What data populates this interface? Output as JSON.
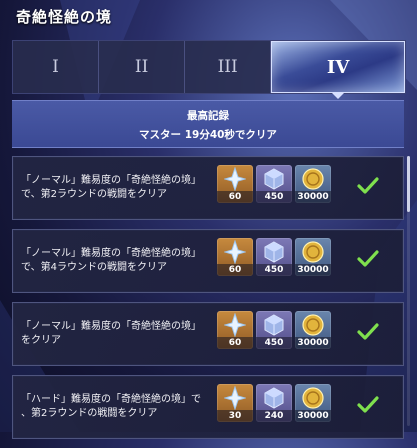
{
  "title": "奇絶怪絶の境",
  "tabs": [
    {
      "label": "I",
      "active": false
    },
    {
      "label": "II",
      "active": false
    },
    {
      "label": "III",
      "active": false
    },
    {
      "label": "IV",
      "active": true
    }
  ],
  "record": {
    "heading": "最高記録",
    "detail": "マスター 19分40秒でクリア"
  },
  "missions": [
    {
      "line1": "「ノーマル」難易度の「奇絶怪絶の境」",
      "line2": "で、第2ラウンドの戦闘をクリア",
      "rewards": [
        {
          "icon": "star-crystal-icon",
          "amount": "60",
          "color": "gold"
        },
        {
          "icon": "cube-material-icon",
          "amount": "450",
          "color": "purple"
        },
        {
          "icon": "gold-coin-icon",
          "amount": "30000",
          "color": "blue"
        }
      ],
      "completed": true
    },
    {
      "line1": "「ノーマル」難易度の「奇絶怪絶の境」",
      "line2": "で、第4ラウンドの戦闘をクリア",
      "rewards": [
        {
          "icon": "star-crystal-icon",
          "amount": "60",
          "color": "gold"
        },
        {
          "icon": "cube-material-icon",
          "amount": "450",
          "color": "purple"
        },
        {
          "icon": "gold-coin-icon",
          "amount": "30000",
          "color": "blue"
        }
      ],
      "completed": true
    },
    {
      "line1": "「ノーマル」難易度の「奇絶怪絶の境」",
      "line2": "をクリア",
      "rewards": [
        {
          "icon": "star-crystal-icon",
          "amount": "60",
          "color": "gold"
        },
        {
          "icon": "cube-material-icon",
          "amount": "450",
          "color": "purple"
        },
        {
          "icon": "gold-coin-icon",
          "amount": "30000",
          "color": "blue"
        }
      ],
      "completed": true
    },
    {
      "line1": "「ハード」難易度の「奇絶怪絶の境」で",
      "line2": "、第2ラウンドの戦闘をクリア",
      "rewards": [
        {
          "icon": "star-crystal-icon",
          "amount": "30",
          "color": "gold"
        },
        {
          "icon": "cube-material-icon",
          "amount": "240",
          "color": "purple"
        },
        {
          "icon": "gold-coin-icon",
          "amount": "30000",
          "color": "blue"
        }
      ],
      "completed": true
    }
  ],
  "colors": {
    "check": "#7fe04e",
    "accent": "#3b4994"
  }
}
